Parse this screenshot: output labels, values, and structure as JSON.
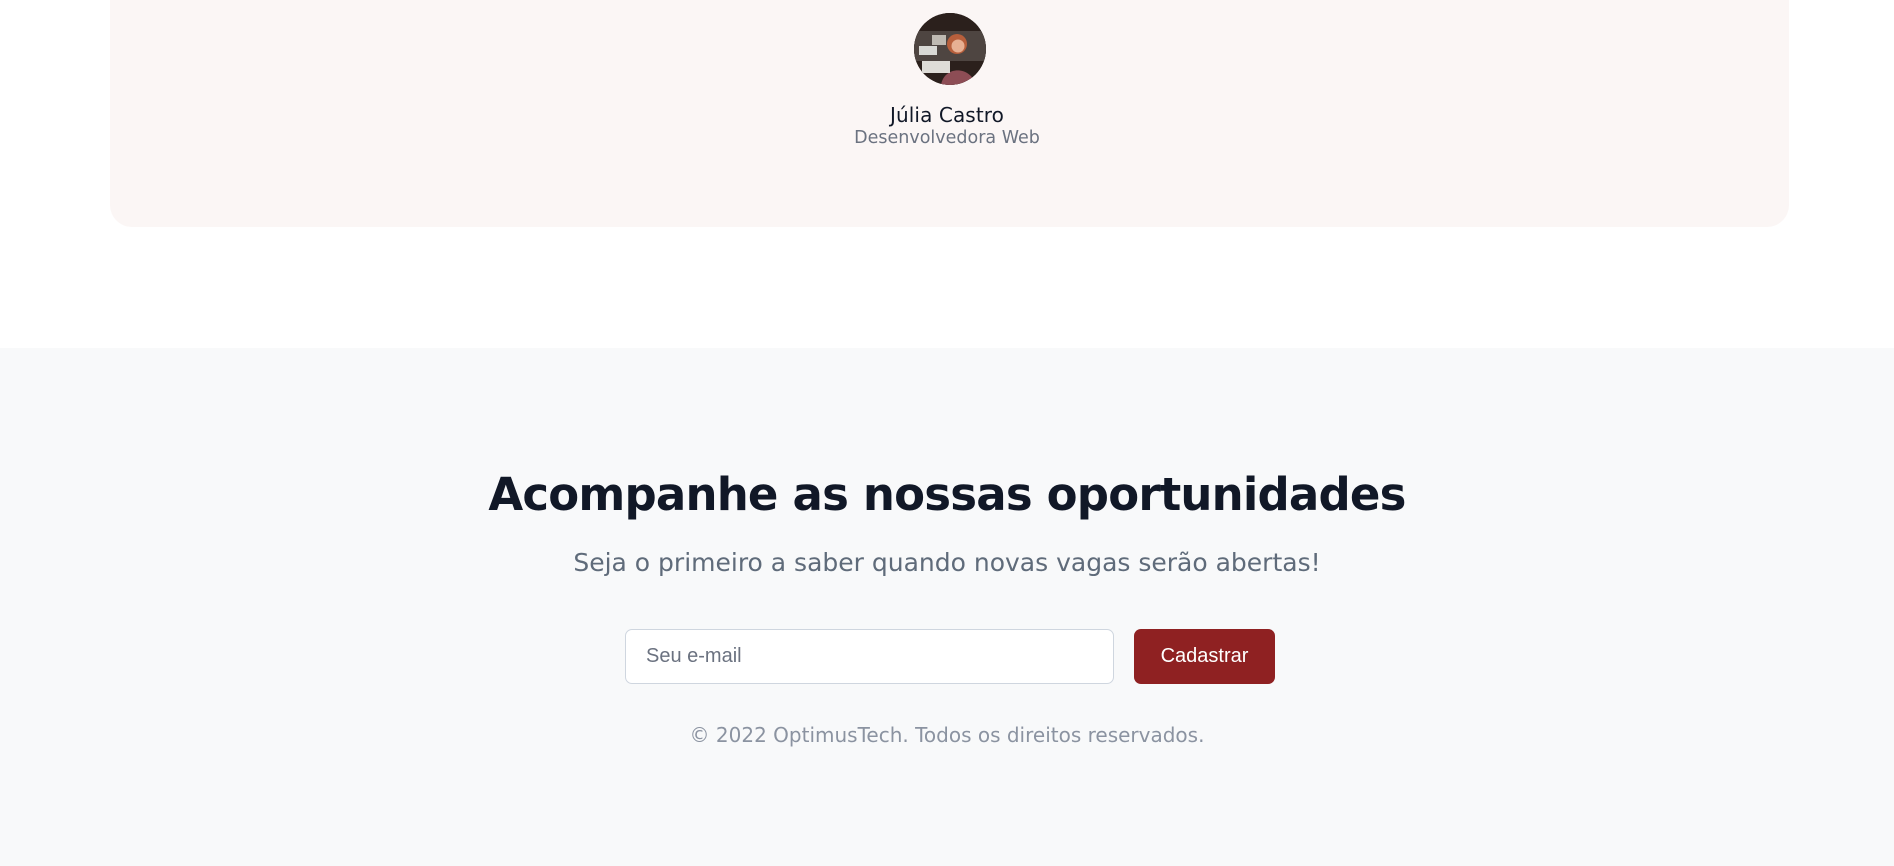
{
  "testimonial": {
    "author_name": "Júlia Castro",
    "author_role": "Desenvolvedora Web",
    "avatar_icon": "user-photo"
  },
  "newsletter": {
    "title": "Acompanhe as nossas oportunidades",
    "subtitle": "Seja o primeiro a saber quando novas vagas serão abertas!",
    "email_placeholder": "Seu e-mail",
    "email_value": "",
    "submit_label": "Cadastrar"
  },
  "footer": {
    "copyright": "© 2022 OptimusTech. Todos os direitos reservados."
  },
  "colors": {
    "card_background": "#fbf6f5",
    "section_background": "#f8f9fa",
    "button_background": "#8f2122",
    "title_text": "#111827",
    "muted_text": "#6b7280"
  }
}
